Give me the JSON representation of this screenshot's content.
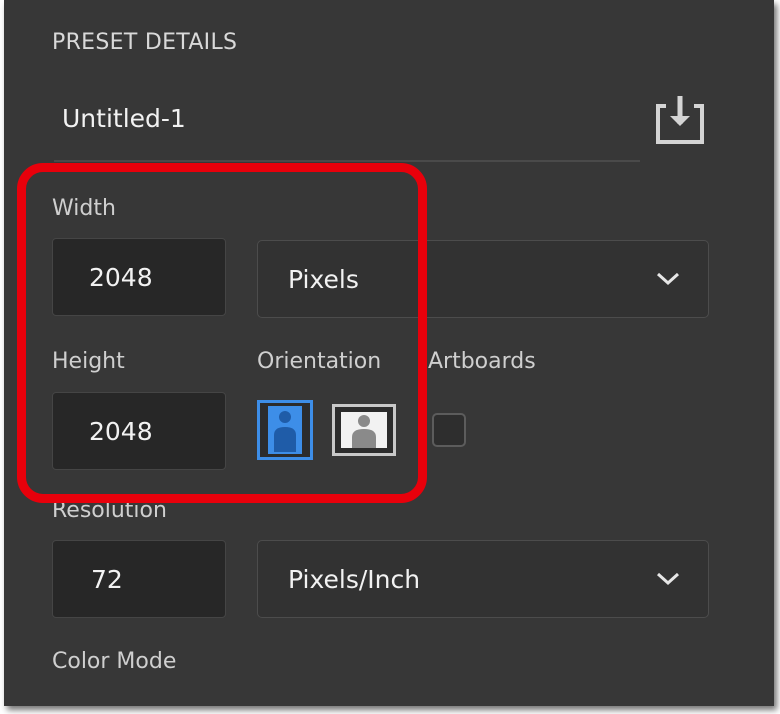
{
  "preset": {
    "section_title": "PRESET DETAILS",
    "document_name": "Untitled-1"
  },
  "width": {
    "label": "Width",
    "value": "2048",
    "unit": "Pixels"
  },
  "height": {
    "label": "Height",
    "value": "2048"
  },
  "orientation": {
    "label": "Orientation",
    "selected": "portrait"
  },
  "artboards": {
    "label": "Artboards",
    "checked": false
  },
  "resolution": {
    "label": "Resolution",
    "value": "72",
    "unit": "Pixels/Inch"
  },
  "color_mode": {
    "label": "Color Mode"
  },
  "colors": {
    "panel": "#373737",
    "accent_blue": "#3d8ee8",
    "highlight_red": "#e8000b"
  },
  "icons": {
    "save_preset": "save-preset-icon",
    "dropdown": "chevron-down-icon",
    "portrait": "portrait-orientation-icon",
    "landscape": "landscape-orientation-icon"
  }
}
